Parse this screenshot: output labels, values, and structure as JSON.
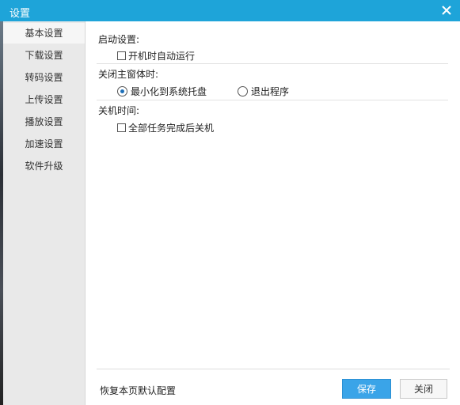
{
  "window": {
    "title": "设置"
  },
  "sidebar": {
    "items": [
      {
        "label": "基本设置"
      },
      {
        "label": "下载设置"
      },
      {
        "label": "转码设置"
      },
      {
        "label": "上传设置"
      },
      {
        "label": "播放设置"
      },
      {
        "label": "加速设置"
      },
      {
        "label": "软件升级"
      }
    ],
    "selected": "基本设置"
  },
  "main": {
    "startup": {
      "label": "启动设置:",
      "auto_run": {
        "label": "开机时自动运行",
        "checked": false
      }
    },
    "close_window": {
      "label": "关闭主窗体时:",
      "options": [
        {
          "label": "最小化到系统托盘",
          "checked": true
        },
        {
          "label": "退出程序",
          "checked": false
        }
      ]
    },
    "shutdown": {
      "label": "关机时间:",
      "after_tasks": {
        "label": "全部任务完成后关机",
        "checked": false
      }
    }
  },
  "footer": {
    "restore_label": "恢复本页默认配置",
    "save_label": "保存",
    "close_label": "关闭"
  },
  "colors": {
    "titlebar": "#1ea4d9",
    "primary_button": "#3aa4e8",
    "sidebar_bg": "#e9e9e9"
  }
}
